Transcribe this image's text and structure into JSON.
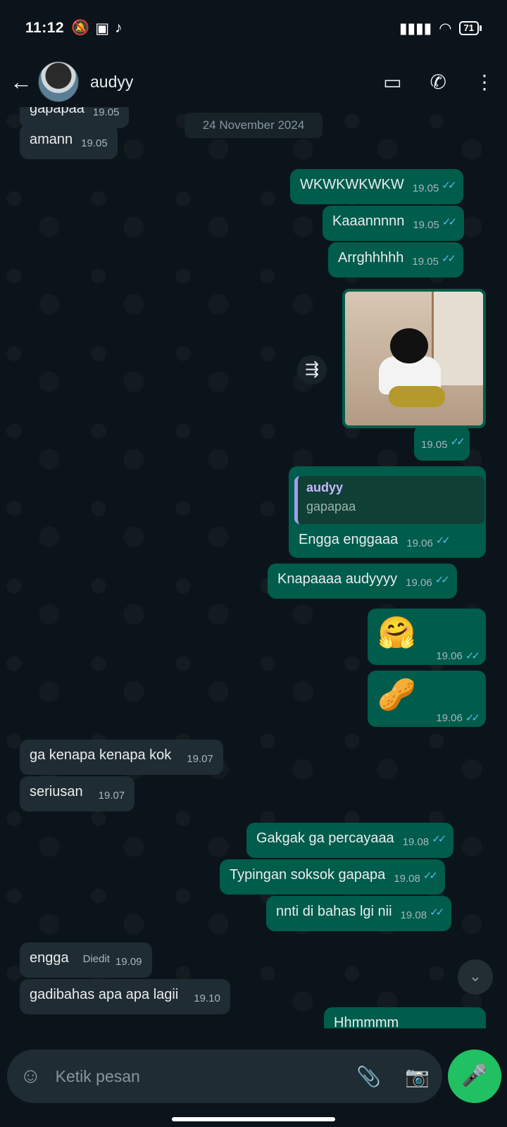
{
  "status_bar": {
    "time": "11:12",
    "battery": "71"
  },
  "header": {
    "back_icon": "←",
    "contact_name": "audyy",
    "video_icon": "▭",
    "call_icon": "✆",
    "menu_icon": "⋮"
  },
  "date_chip": "24 November 2024",
  "messages": [
    {
      "dir": "in",
      "text": "gapapaa",
      "time": "19.05"
    },
    {
      "dir": "in",
      "text": "amann",
      "time": "19.05"
    },
    {
      "dir": "out",
      "text": "WKWKWKWKW",
      "time": "19.05",
      "ticks": "✓✓"
    },
    {
      "dir": "out",
      "text": "Kaaannnnn",
      "time": "19.05",
      "ticks": "✓✓"
    },
    {
      "dir": "out",
      "text": "Arrghhhhh",
      "time": "19.05",
      "ticks": "✓✓"
    },
    {
      "dir": "out",
      "type": "image",
      "time": "19.05",
      "ticks": "✓✓"
    },
    {
      "dir": "out",
      "text": "Engga enggaaa",
      "time": "19.06",
      "ticks": "✓✓",
      "reply_to": {
        "name": "audyy",
        "text": "gapapaa"
      }
    },
    {
      "dir": "out",
      "text": "Knapaaaa audyyyy",
      "time": "19.06",
      "ticks": "✓✓"
    },
    {
      "dir": "out",
      "emoji": "🤗",
      "time": "19.06",
      "ticks": "✓✓"
    },
    {
      "dir": "out",
      "emoji": "🥜",
      "time": "19.06",
      "ticks": "✓✓"
    },
    {
      "dir": "in",
      "text": "ga kenapa kenapa kok",
      "time": "19.07"
    },
    {
      "dir": "in",
      "text": "seriusan",
      "time": "19.07"
    },
    {
      "dir": "out",
      "text": "Gakgak ga percayaaa",
      "time": "19.08",
      "ticks": "✓✓"
    },
    {
      "dir": "out",
      "text": "Typingan soksok gapapa",
      "time": "19.08",
      "ticks": "✓✓"
    },
    {
      "dir": "out",
      "text": "nnti di bahas lgi nii",
      "time": "19.08",
      "ticks": "✓✓"
    },
    {
      "dir": "in",
      "text": "engga",
      "edited": "Diedit",
      "time": "19.09"
    },
    {
      "dir": "in",
      "text": "gadibahas apa apa lagii",
      "time": "19.10"
    },
    {
      "dir": "out",
      "text": "Hhmmmm",
      "time": "",
      "ticks": "✓✓"
    }
  ],
  "forward_icon": "⇶",
  "scroll_down_icon": "⌄",
  "composer": {
    "placeholder": "Ketik pesan",
    "emoji_icon": "☺",
    "attach_icon": "📎",
    "camera_icon": "📷",
    "mic_icon": "🎤"
  }
}
